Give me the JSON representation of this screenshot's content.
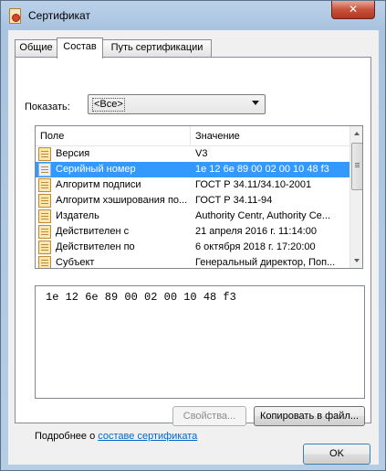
{
  "window": {
    "title": "Сертификат",
    "close_glyph": "✕"
  },
  "tabs": [
    {
      "label": "Общие",
      "active": false
    },
    {
      "label": "Состав",
      "active": true
    },
    {
      "label": "Путь сертификации",
      "active": false
    }
  ],
  "show": {
    "label": "Показать:",
    "selected": "<Все>"
  },
  "list": {
    "columns": [
      "Поле",
      "Значение"
    ],
    "rows": [
      {
        "field": "Версия",
        "value": "V3",
        "selected": false
      },
      {
        "field": "Серийный номер",
        "value": "1e 12 6e 89 00 02 00 10 48 f3",
        "selected": true
      },
      {
        "field": "Алгоритм подписи",
        "value": "ГОСТ Р 34.11/34.10-2001",
        "selected": false
      },
      {
        "field": "Алгоритм хэширования по...",
        "value": "ГОСТ Р 34.11-94",
        "selected": false
      },
      {
        "field": "Издатель",
        "value": "Authority Centr, Authority Ce...",
        "selected": false
      },
      {
        "field": "Действителен с",
        "value": "21 апреля 2016 г. 11:14:00",
        "selected": false
      },
      {
        "field": "Действителен по",
        "value": "6 октября 2018 г. 17:20:00",
        "selected": false
      },
      {
        "field": "Субъект",
        "value": "Генеральный директор, Поп...",
        "selected": false
      }
    ]
  },
  "detail": {
    "text": "1e 12 6e 89 00 02 00 10 48 f3"
  },
  "buttons": {
    "properties": "Свойства...",
    "copy_to_file": "Копировать в файл...",
    "ok": "OK"
  },
  "more_info": {
    "prefix": "Подробнее о ",
    "link": "составе сертификата"
  }
}
